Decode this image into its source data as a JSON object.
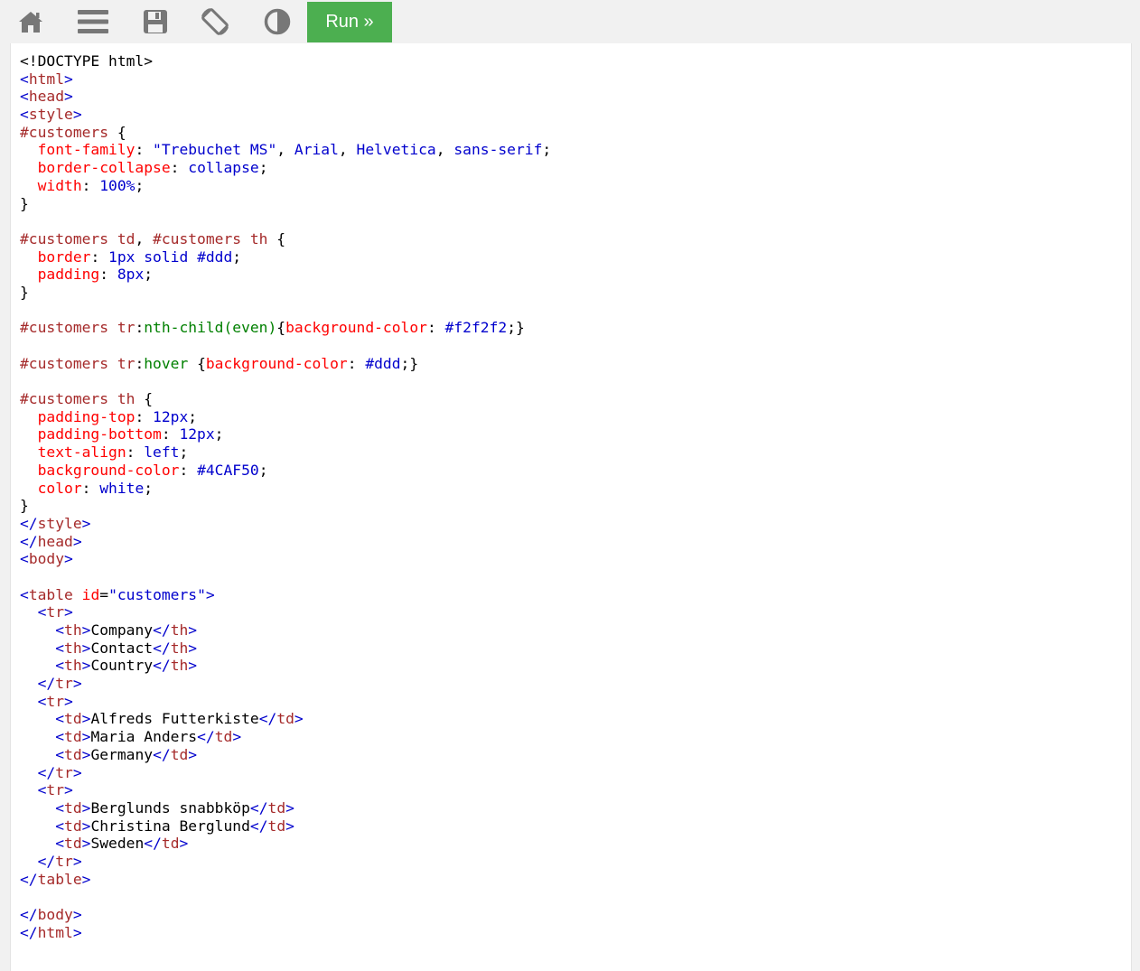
{
  "toolbar": {
    "icons": [
      "home-icon",
      "menu-icon",
      "save-icon",
      "rotate-icon",
      "contrast-icon"
    ],
    "run_label": "Run »",
    "run_color": "#4CAF50"
  },
  "colors": {
    "tag": "#a52a2a",
    "bracket": "#0000cd",
    "attr_name": "#ff0000",
    "attr_value": "#0000cd",
    "selector": "#a52a2a",
    "property": "#ff0000",
    "value": "#0000cd",
    "pseudo_class": "#008000",
    "text": "#000000"
  },
  "code_lines": [
    [
      [
        "txt",
        "<!DOCTYPE html>"
      ]
    ],
    [
      [
        "br",
        "<"
      ],
      [
        "tag",
        "html"
      ],
      [
        "br",
        ">"
      ]
    ],
    [
      [
        "br",
        "<"
      ],
      [
        "tag",
        "head"
      ],
      [
        "br",
        ">"
      ]
    ],
    [
      [
        "br",
        "<"
      ],
      [
        "tag",
        "style"
      ],
      [
        "br",
        ">"
      ]
    ],
    [
      [
        "sel",
        "#customers"
      ],
      [
        "txt",
        " {"
      ]
    ],
    [
      [
        "txt",
        "  "
      ],
      [
        "prop",
        "font-family"
      ],
      [
        "txt",
        ": "
      ],
      [
        "pval",
        "\"Trebuchet MS\""
      ],
      [
        "txt",
        ", "
      ],
      [
        "pval",
        "Arial"
      ],
      [
        "txt",
        ", "
      ],
      [
        "pval",
        "Helvetica"
      ],
      [
        "txt",
        ", "
      ],
      [
        "pval",
        "sans-serif"
      ],
      [
        "txt",
        ";"
      ]
    ],
    [
      [
        "txt",
        "  "
      ],
      [
        "prop",
        "border-collapse"
      ],
      [
        "txt",
        ": "
      ],
      [
        "pval",
        "collapse"
      ],
      [
        "txt",
        ";"
      ]
    ],
    [
      [
        "txt",
        "  "
      ],
      [
        "prop",
        "width"
      ],
      [
        "txt",
        ": "
      ],
      [
        "pval",
        "100%"
      ],
      [
        "txt",
        ";"
      ]
    ],
    [
      [
        "txt",
        "}"
      ]
    ],
    [],
    [
      [
        "sel",
        "#customers td"
      ],
      [
        "txt",
        ", "
      ],
      [
        "sel",
        "#customers th"
      ],
      [
        "txt",
        " {"
      ]
    ],
    [
      [
        "txt",
        "  "
      ],
      [
        "prop",
        "border"
      ],
      [
        "txt",
        ": "
      ],
      [
        "pval",
        "1px solid #ddd"
      ],
      [
        "txt",
        ";"
      ]
    ],
    [
      [
        "txt",
        "  "
      ],
      [
        "prop",
        "padding"
      ],
      [
        "txt",
        ": "
      ],
      [
        "pval",
        "8px"
      ],
      [
        "txt",
        ";"
      ]
    ],
    [
      [
        "txt",
        "}"
      ]
    ],
    [],
    [
      [
        "sel",
        "#customers tr"
      ],
      [
        "txt",
        ":"
      ],
      [
        "pc",
        "nth-child(even)"
      ],
      [
        "txt",
        "{"
      ],
      [
        "prop",
        "background-color"
      ],
      [
        "txt",
        ": "
      ],
      [
        "pval",
        "#f2f2f2"
      ],
      [
        "txt",
        ";}"
      ]
    ],
    [],
    [
      [
        "sel",
        "#customers tr"
      ],
      [
        "txt",
        ":"
      ],
      [
        "pc",
        "hover"
      ],
      [
        "txt",
        " {"
      ],
      [
        "prop",
        "background-color"
      ],
      [
        "txt",
        ": "
      ],
      [
        "pval",
        "#ddd"
      ],
      [
        "txt",
        ";}"
      ]
    ],
    [],
    [
      [
        "sel",
        "#customers th"
      ],
      [
        "txt",
        " {"
      ]
    ],
    [
      [
        "txt",
        "  "
      ],
      [
        "prop",
        "padding-top"
      ],
      [
        "txt",
        ": "
      ],
      [
        "pval",
        "12px"
      ],
      [
        "txt",
        ";"
      ]
    ],
    [
      [
        "txt",
        "  "
      ],
      [
        "prop",
        "padding-bottom"
      ],
      [
        "txt",
        ": "
      ],
      [
        "pval",
        "12px"
      ],
      [
        "txt",
        ";"
      ]
    ],
    [
      [
        "txt",
        "  "
      ],
      [
        "prop",
        "text-align"
      ],
      [
        "txt",
        ": "
      ],
      [
        "pval",
        "left"
      ],
      [
        "txt",
        ";"
      ]
    ],
    [
      [
        "txt",
        "  "
      ],
      [
        "prop",
        "background-color"
      ],
      [
        "txt",
        ": "
      ],
      [
        "pval",
        "#4CAF50"
      ],
      [
        "txt",
        ";"
      ]
    ],
    [
      [
        "txt",
        "  "
      ],
      [
        "prop",
        "color"
      ],
      [
        "txt",
        ": "
      ],
      [
        "pval",
        "white"
      ],
      [
        "txt",
        ";"
      ]
    ],
    [
      [
        "txt",
        "}"
      ]
    ],
    [
      [
        "br",
        "</"
      ],
      [
        "tag",
        "style"
      ],
      [
        "br",
        ">"
      ]
    ],
    [
      [
        "br",
        "</"
      ],
      [
        "tag",
        "head"
      ],
      [
        "br",
        ">"
      ]
    ],
    [
      [
        "br",
        "<"
      ],
      [
        "tag",
        "body"
      ],
      [
        "br",
        ">"
      ]
    ],
    [],
    [
      [
        "br",
        "<"
      ],
      [
        "tag",
        "table"
      ],
      [
        "txt",
        " "
      ],
      [
        "attr",
        "id"
      ],
      [
        "txt",
        "="
      ],
      [
        "aval",
        "\"customers\""
      ],
      [
        "br",
        ">"
      ]
    ],
    [
      [
        "txt",
        "  "
      ],
      [
        "br",
        "<"
      ],
      [
        "tag",
        "tr"
      ],
      [
        "br",
        ">"
      ]
    ],
    [
      [
        "txt",
        "    "
      ],
      [
        "br",
        "<"
      ],
      [
        "tag",
        "th"
      ],
      [
        "br",
        ">"
      ],
      [
        "txt",
        "Company"
      ],
      [
        "br",
        "</"
      ],
      [
        "tag",
        "th"
      ],
      [
        "br",
        ">"
      ]
    ],
    [
      [
        "txt",
        "    "
      ],
      [
        "br",
        "<"
      ],
      [
        "tag",
        "th"
      ],
      [
        "br",
        ">"
      ],
      [
        "txt",
        "Contact"
      ],
      [
        "br",
        "</"
      ],
      [
        "tag",
        "th"
      ],
      [
        "br",
        ">"
      ]
    ],
    [
      [
        "txt",
        "    "
      ],
      [
        "br",
        "<"
      ],
      [
        "tag",
        "th"
      ],
      [
        "br",
        ">"
      ],
      [
        "txt",
        "Country"
      ],
      [
        "br",
        "</"
      ],
      [
        "tag",
        "th"
      ],
      [
        "br",
        ">"
      ]
    ],
    [
      [
        "txt",
        "  "
      ],
      [
        "br",
        "</"
      ],
      [
        "tag",
        "tr"
      ],
      [
        "br",
        ">"
      ]
    ],
    [
      [
        "txt",
        "  "
      ],
      [
        "br",
        "<"
      ],
      [
        "tag",
        "tr"
      ],
      [
        "br",
        ">"
      ]
    ],
    [
      [
        "txt",
        "    "
      ],
      [
        "br",
        "<"
      ],
      [
        "tag",
        "td"
      ],
      [
        "br",
        ">"
      ],
      [
        "txt",
        "Alfreds Futterkiste"
      ],
      [
        "br",
        "</"
      ],
      [
        "tag",
        "td"
      ],
      [
        "br",
        ">"
      ]
    ],
    [
      [
        "txt",
        "    "
      ],
      [
        "br",
        "<"
      ],
      [
        "tag",
        "td"
      ],
      [
        "br",
        ">"
      ],
      [
        "txt",
        "Maria Anders"
      ],
      [
        "br",
        "</"
      ],
      [
        "tag",
        "td"
      ],
      [
        "br",
        ">"
      ]
    ],
    [
      [
        "txt",
        "    "
      ],
      [
        "br",
        "<"
      ],
      [
        "tag",
        "td"
      ],
      [
        "br",
        ">"
      ],
      [
        "txt",
        "Germany"
      ],
      [
        "br",
        "</"
      ],
      [
        "tag",
        "td"
      ],
      [
        "br",
        ">"
      ]
    ],
    [
      [
        "txt",
        "  "
      ],
      [
        "br",
        "</"
      ],
      [
        "tag",
        "tr"
      ],
      [
        "br",
        ">"
      ]
    ],
    [
      [
        "txt",
        "  "
      ],
      [
        "br",
        "<"
      ],
      [
        "tag",
        "tr"
      ],
      [
        "br",
        ">"
      ]
    ],
    [
      [
        "txt",
        "    "
      ],
      [
        "br",
        "<"
      ],
      [
        "tag",
        "td"
      ],
      [
        "br",
        ">"
      ],
      [
        "txt",
        "Berglunds snabbköp"
      ],
      [
        "br",
        "</"
      ],
      [
        "tag",
        "td"
      ],
      [
        "br",
        ">"
      ]
    ],
    [
      [
        "txt",
        "    "
      ],
      [
        "br",
        "<"
      ],
      [
        "tag",
        "td"
      ],
      [
        "br",
        ">"
      ],
      [
        "txt",
        "Christina Berglund"
      ],
      [
        "br",
        "</"
      ],
      [
        "tag",
        "td"
      ],
      [
        "br",
        ">"
      ]
    ],
    [
      [
        "txt",
        "    "
      ],
      [
        "br",
        "<"
      ],
      [
        "tag",
        "td"
      ],
      [
        "br",
        ">"
      ],
      [
        "txt",
        "Sweden"
      ],
      [
        "br",
        "</"
      ],
      [
        "tag",
        "td"
      ],
      [
        "br",
        ">"
      ]
    ],
    [
      [
        "txt",
        "  "
      ],
      [
        "br",
        "</"
      ],
      [
        "tag",
        "tr"
      ],
      [
        "br",
        ">"
      ]
    ],
    [
      [
        "br",
        "</"
      ],
      [
        "tag",
        "table"
      ],
      [
        "br",
        ">"
      ]
    ],
    [],
    [
      [
        "br",
        "</"
      ],
      [
        "tag",
        "body"
      ],
      [
        "br",
        ">"
      ]
    ],
    [
      [
        "br",
        "</"
      ],
      [
        "tag",
        "html"
      ],
      [
        "br",
        ">"
      ]
    ]
  ]
}
